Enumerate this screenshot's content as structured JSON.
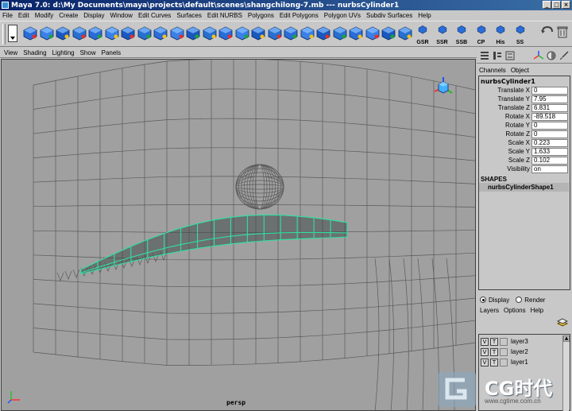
{
  "window": {
    "title": "Maya 7.0: d:\\My Documents\\maya\\projects\\default\\scenes\\shangchilong-7.mb  ---  nurbsCylinder1",
    "buttons": [
      "_",
      "□",
      "×"
    ]
  },
  "menubar": {
    "items": [
      "File",
      "Edit",
      "Modify",
      "Create",
      "Display",
      "Window",
      "Edit Curves",
      "Surfaces",
      "Edit NURBS",
      "Polygons",
      "Edit Polygons",
      "Polygon UVs",
      "Subdiv Surfaces",
      "Help"
    ]
  },
  "shelf": {
    "tool_icons": [
      "cube-icon",
      "sphere-icon",
      "cylinder-icon",
      "plane-icon",
      "torus-icon",
      "cone-icon",
      "camera-icon",
      "extrude-icon",
      "bevel-icon",
      "split-icon",
      "merge-icon",
      "smooth-icon",
      "mirror-icon",
      "cut-icon",
      "append-icon",
      "wedge-icon",
      "combine-icon",
      "separate-icon",
      "fill-icon",
      "bridge-icon",
      "subdivide-icon",
      "triangulate-icon",
      "quadrangulate-icon",
      "uv-icon"
    ],
    "labeled_tools": [
      {
        "label": "GSR"
      },
      {
        "label": "SSR"
      },
      {
        "label": "SSB"
      },
      {
        "label": "CP"
      },
      {
        "label": "His"
      },
      {
        "label": "SS"
      }
    ]
  },
  "viewport": {
    "menu": [
      "View",
      "Shading",
      "Lighting",
      "Show",
      "Panels"
    ],
    "camera": "persp"
  },
  "right_toolbar": {
    "icons": [
      "channel-box-icon",
      "attribute-icon",
      "tool-settings-icon",
      "axis-icon",
      "sphere-icon",
      "brush-icon"
    ]
  },
  "channel_box": {
    "tabs": [
      "Channels",
      "Object"
    ],
    "node": "nurbsCylinder1",
    "attributes": [
      {
        "name": "Translate X",
        "value": "0"
      },
      {
        "name": "Translate Y",
        "value": "7.95"
      },
      {
        "name": "Translate Z",
        "value": "6.831"
      },
      {
        "name": "Rotate X",
        "value": "-89.518"
      },
      {
        "name": "Rotate Y",
        "value": "0"
      },
      {
        "name": "Rotate Z",
        "value": "0"
      },
      {
        "name": "Scale X",
        "value": "0.223"
      },
      {
        "name": "Scale Y",
        "value": "1.633"
      },
      {
        "name": "Scale Z",
        "value": "0.102"
      },
      {
        "name": "Visibility",
        "value": "on"
      }
    ],
    "shapes_header": "SHAPES",
    "shape": "nurbsCylinderShape1"
  },
  "layers": {
    "display_label": "Display",
    "render_label": "Render",
    "mode": "Display",
    "menu": [
      "Layers",
      "Options",
      "Help"
    ],
    "items": [
      {
        "v": "V",
        "t": "T",
        "name": "layer3"
      },
      {
        "v": "V",
        "t": "T",
        "name": "layer2"
      },
      {
        "v": "V",
        "t": "T",
        "name": "layer1"
      }
    ]
  },
  "watermark": {
    "brand": "CG时代",
    "url": "www.cgtime.com.cn"
  },
  "colors": {
    "viewport_bg": "#a0a0a0",
    "wireframe": "#5a5a5a",
    "selected_wire": "#30e0a0",
    "title_start": "#0a246a",
    "title_end": "#3a6ea5"
  }
}
